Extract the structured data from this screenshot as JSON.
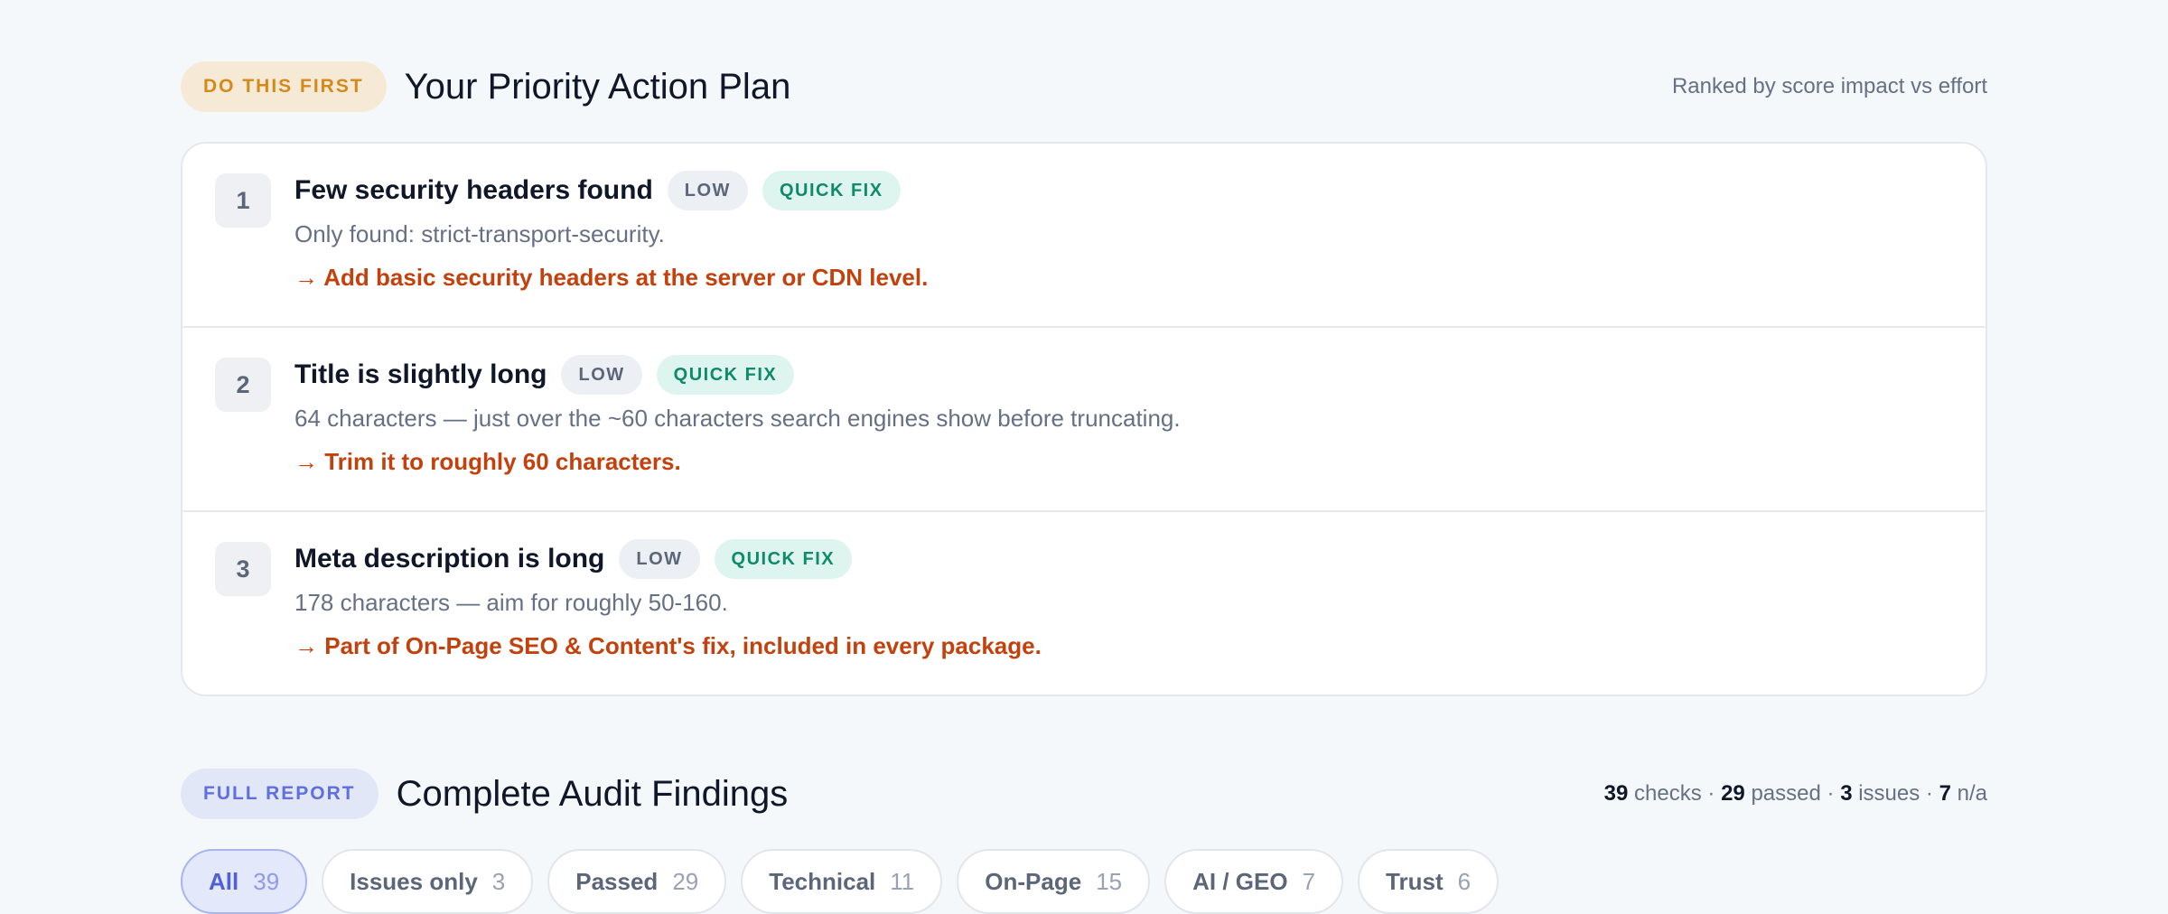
{
  "priority": {
    "tag": "DO THIS FIRST",
    "title": "Your Priority Action Plan",
    "meta": "Ranked by score impact vs effort",
    "items": [
      {
        "num": "1",
        "title": "Few security headers found",
        "severity": "LOW",
        "effort": "QUICK FIX",
        "description": "Only found: strict-transport-security.",
        "action": "→ Add basic security headers at the server or CDN level."
      },
      {
        "num": "2",
        "title": "Title is slightly long",
        "severity": "LOW",
        "effort": "QUICK FIX",
        "description": "64 characters — just over the ~60 characters search engines show before truncating.",
        "action": "→ Trim it to roughly 60 characters."
      },
      {
        "num": "3",
        "title": "Meta description is long",
        "severity": "LOW",
        "effort": "QUICK FIX",
        "description": "178 characters — aim for roughly 50-160.",
        "action": "→ Part of On-Page SEO & Content's fix, included in every package."
      }
    ]
  },
  "report": {
    "tag": "FULL REPORT",
    "title": "Complete Audit Findings",
    "summary": {
      "checks": "39",
      "checks_label": "checks",
      "passed": "29",
      "passed_label": "passed",
      "issues": "3",
      "issues_label": "issues",
      "na": "7",
      "na_label": "n/a",
      "separator": "·"
    },
    "filters": [
      {
        "label": "All",
        "count": "39",
        "active": true
      },
      {
        "label": "Issues only",
        "count": "3",
        "active": false
      },
      {
        "label": "Passed",
        "count": "29",
        "active": false
      },
      {
        "label": "Technical",
        "count": "11",
        "active": false
      },
      {
        "label": "On-Page",
        "count": "15",
        "active": false
      },
      {
        "label": "AI / GEO",
        "count": "7",
        "active": false
      },
      {
        "label": "Trust",
        "count": "6",
        "active": false
      }
    ]
  },
  "colors": {
    "amber_tag": "#d4891b",
    "indigo_tag": "#5f6ee0",
    "action_text": "#c2410c",
    "quick_fix": "#0f8a6b"
  }
}
